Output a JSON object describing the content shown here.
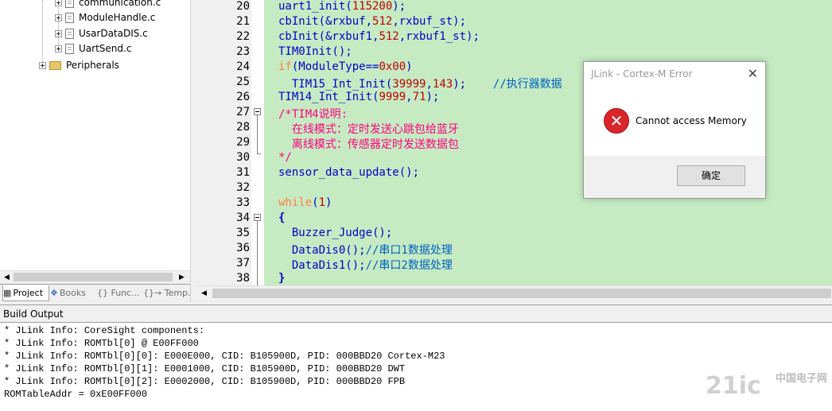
{
  "project_tree": {
    "files": [
      "communication.c",
      "ModuleHandle.c",
      "UsarDataDIS.c",
      "UartSend.c"
    ],
    "folder": "Peripherals"
  },
  "project_tabs": [
    {
      "label": "Project",
      "icon": "project-icon"
    },
    {
      "label": "Books",
      "icon": "books-icon"
    },
    {
      "label": "{} Func...",
      "icon": "functions-icon"
    },
    {
      "label": "{}→ Temp...",
      "icon": "templates-icon"
    }
  ],
  "editor": {
    "line_numbers": [
      "20",
      "21",
      "22",
      "23",
      "24",
      "25",
      "26",
      "27",
      "28",
      "29",
      "30",
      "31",
      "32",
      "33",
      "34",
      "35",
      "36",
      "37",
      "38"
    ]
  },
  "build_output": {
    "title": "Build Output",
    "lines": [
      "* JLink Info: CoreSight components:",
      "* JLink Info: ROMTbl[0] @ E00FF000",
      "* JLink Info: ROMTbl[0][0]: E000E000, CID: B105900D, PID: 000BBD20 Cortex-M23",
      "* JLink Info: ROMTbl[0][1]: E0001000, CID: B105900D, PID: 000BBD20 DWT",
      "* JLink Info: ROMTbl[0][2]: E0002000, CID: B105900D, PID: 000BBD20 FPB",
      "ROMTableAddr = 0xE00FF000"
    ]
  },
  "dialog": {
    "title": "JLink - Cortex-M Error",
    "close_label": "✕",
    "message": "Cannot access Memory",
    "ok_label": "确定",
    "icon": "error-icon"
  },
  "watermark": {
    "text": "21ic",
    "sub": "中国电子网"
  },
  "colors": {
    "editor_bg": "#c6ebc3",
    "keyword": "#ff8040",
    "number": "#c00000",
    "comment": "#0060c0",
    "comment_block": "#ff0080",
    "identifier": "#0000c8"
  },
  "code": {
    "l20a": "uart1_init(",
    "l20n": "115200",
    "l20b": ");",
    "l21a": "cbInit(&rxbuf,",
    "l21n": "512",
    "l21b": ",rxbuf_st);",
    "l22a": "cbInit(&rxbuf1,",
    "l22n": "512",
    "l22b": ",rxbuf1_st);",
    "l23": "TIM0Init();",
    "l24k": "if",
    "l24a": "(ModuleType==",
    "l24n": "0x00",
    "l24b": ")",
    "l25a": "  TIM15_Int_Init(",
    "l25n1": "39999",
    "l25c": ",",
    "l25n2": "143",
    "l25b": ");    ",
    "l25cm": "//执行器数据",
    "l26a": "TIM14_Int_Init(",
    "l26n1": "9999",
    "l26c": ",",
    "l26n2": "71",
    "l26b": ");",
    "l27": "/*TIM4说明:",
    "l28": "  在线模式：定时发送心跳包给蓝牙",
    "l29": "  离线模式：传感器定时发送数据包",
    "l30": "*/",
    "l31": "sensor_data_update();",
    "l33k": "while",
    "l33a": "(",
    "l33n": "1",
    "l33b": ")",
    "l34": "{",
    "l35": "  Buzzer_Judge();",
    "l36a": "  DataDis0();",
    "l36cm": "//串口1数据处理",
    "l37a": "  DataDis1();",
    "l37cm": "//串口2数据处理",
    "l38": "}"
  }
}
